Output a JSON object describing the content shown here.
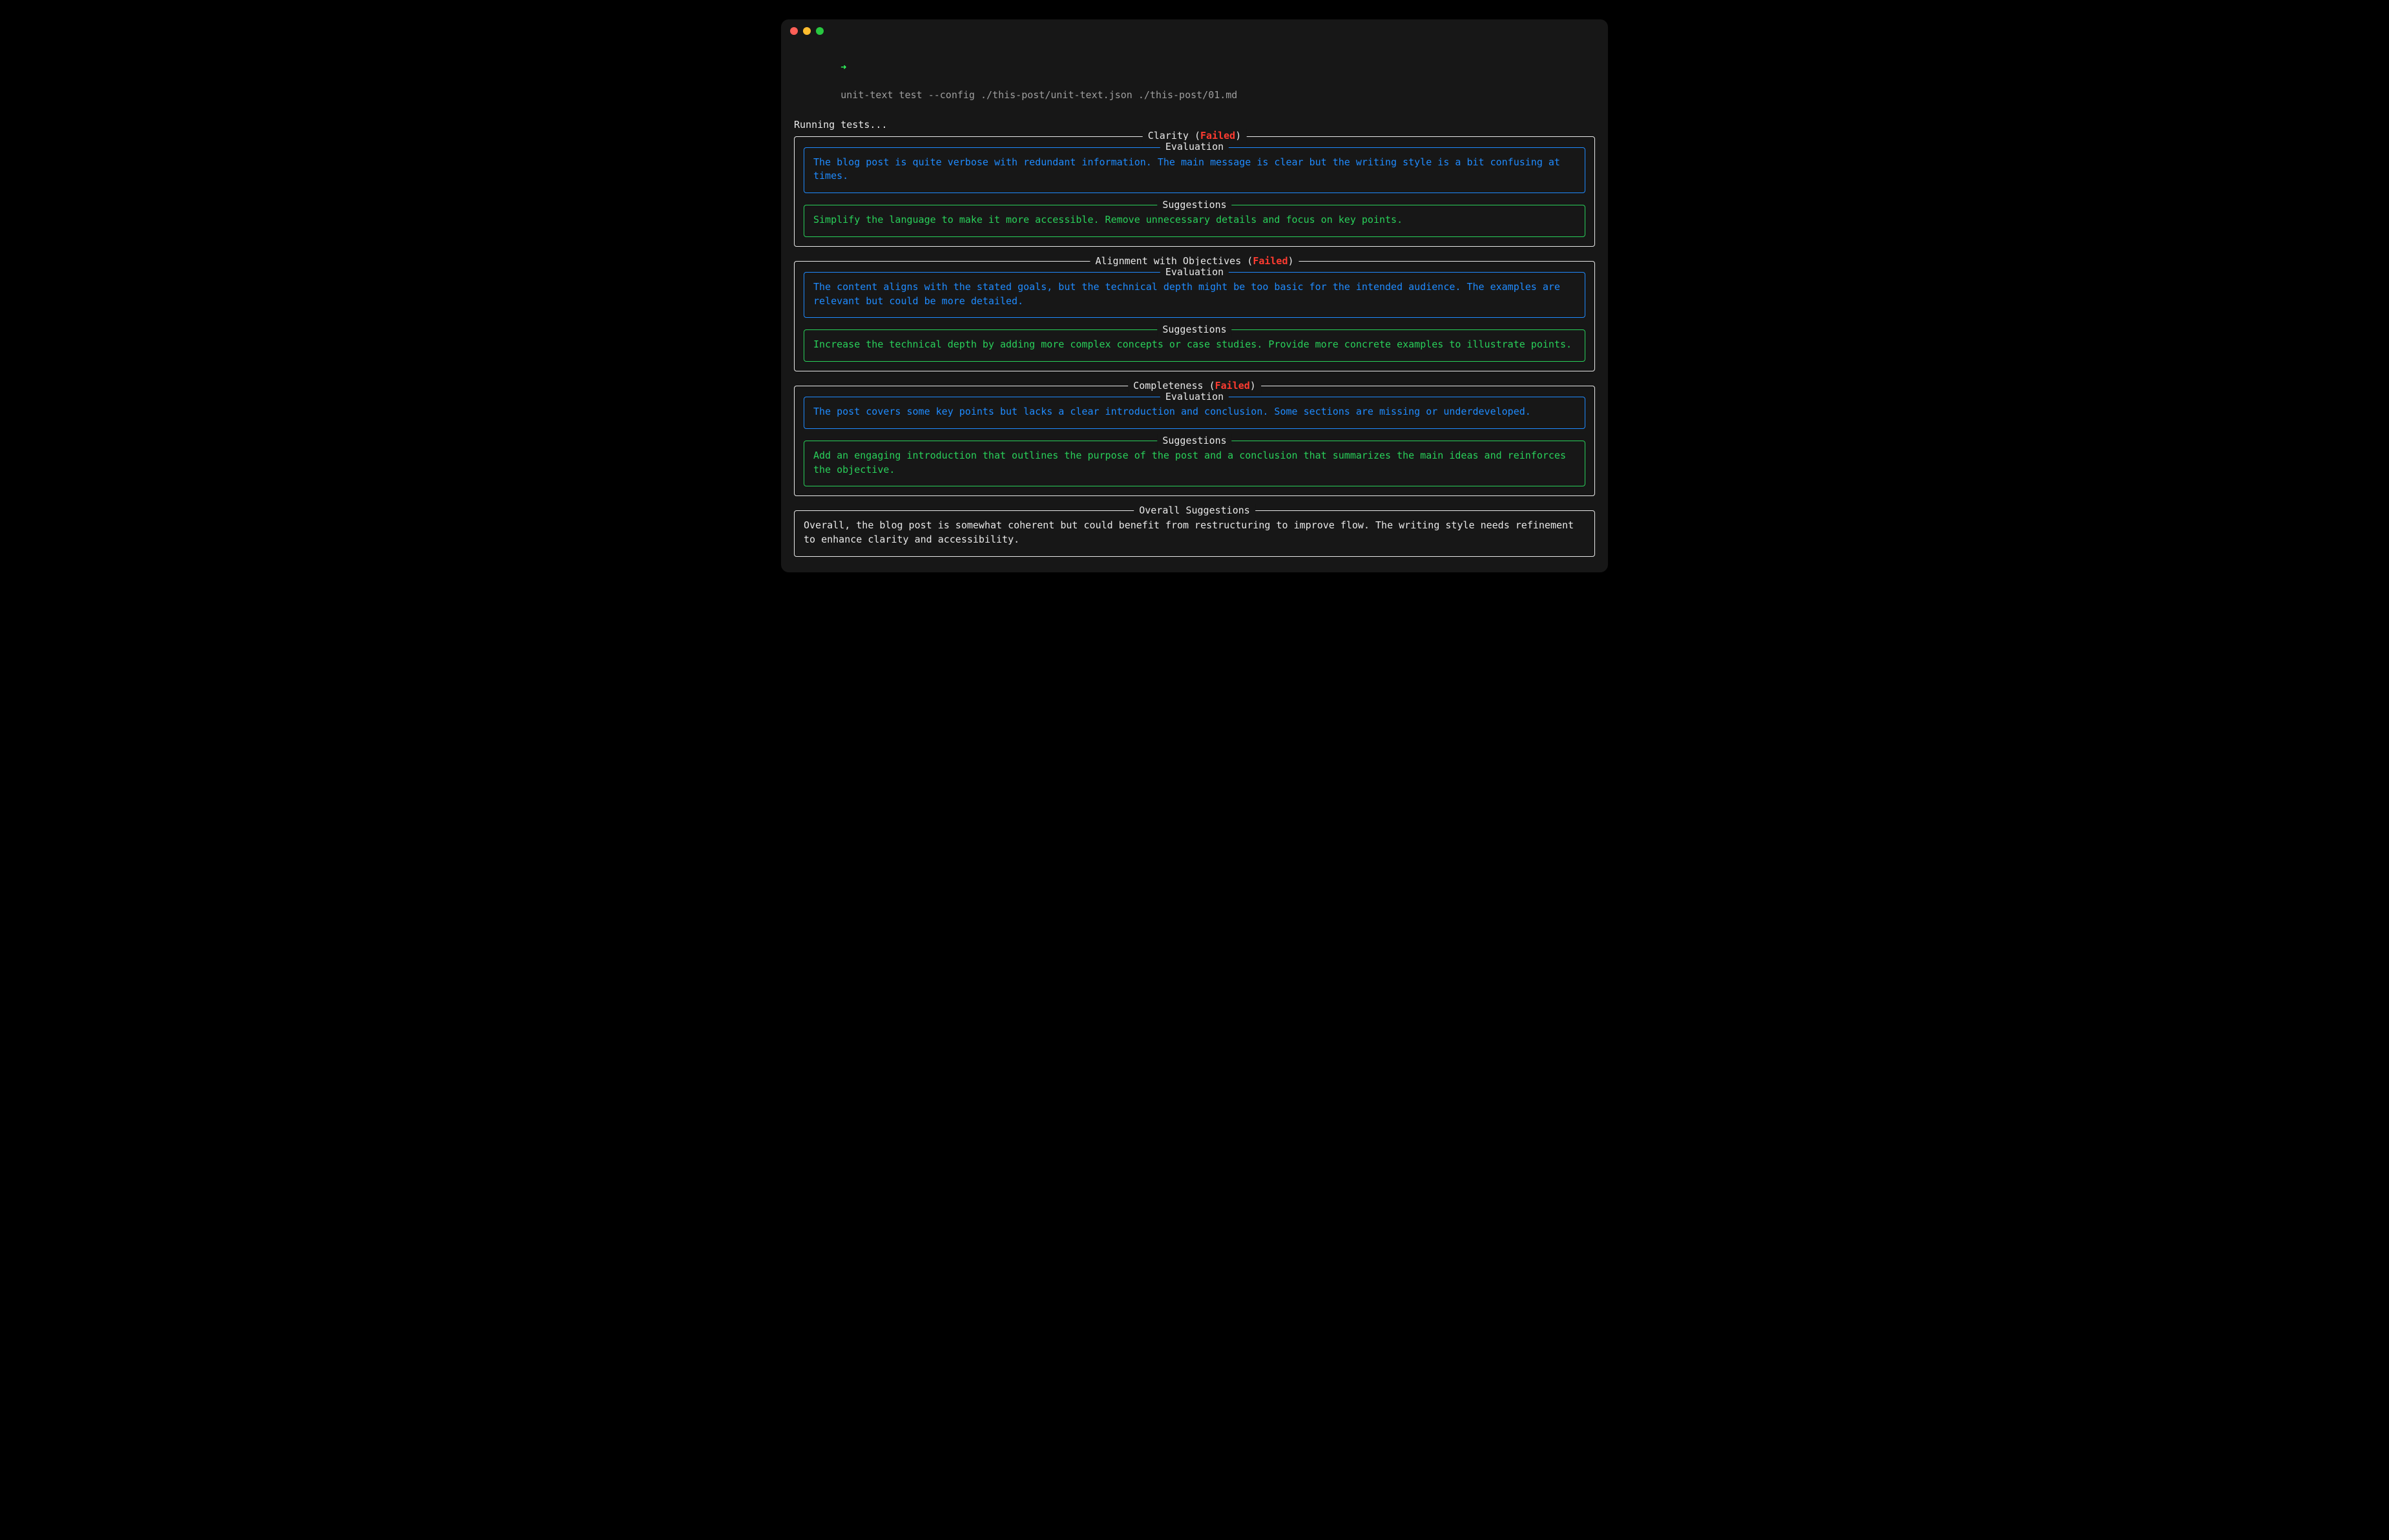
{
  "colors": {
    "bg": "#171717",
    "white": "#e8e8e8",
    "blue": "#1f8bff",
    "green": "#29d05a",
    "fail": "#ff3b30",
    "grey": "#9e9e9e"
  },
  "prompt": {
    "arrow": "➜",
    "command": "unit-text test --config ./this-post/unit-text.json ./this-post/01.md"
  },
  "running_line": "Running tests...",
  "labels": {
    "evaluation": "Evaluation",
    "suggestions": "Suggestions",
    "overall": "Overall Suggestions",
    "status_failed": "Failed"
  },
  "sections": [
    {
      "title": "Clarity",
      "status": "Failed",
      "evaluation": "The blog post is quite verbose with redundant information. The main message is clear but the writing style is a bit confusing at times.",
      "suggestions": "Simplify the language to make it more accessible. Remove unnecessary details and focus on key points."
    },
    {
      "title": "Alignment with Objectives",
      "status": "Failed",
      "evaluation": "The content aligns with the stated goals, but the technical depth might be too basic for the intended audience. The examples are relevant but could be more detailed.",
      "suggestions": "Increase the technical depth by adding more complex concepts or case studies. Provide more concrete examples to illustrate points."
    },
    {
      "title": "Completeness",
      "status": "Failed",
      "evaluation": "The post covers some key points but lacks a clear introduction and conclusion. Some sections are missing or underdeveloped.",
      "suggestions": "Add an engaging introduction that outlines the purpose of the post and a conclusion that summarizes the main ideas and reinforces the objective."
    }
  ],
  "overall": "Overall, the blog post is somewhat coherent but could benefit from restructuring to improve flow. The writing style needs refinement to enhance clarity and accessibility."
}
